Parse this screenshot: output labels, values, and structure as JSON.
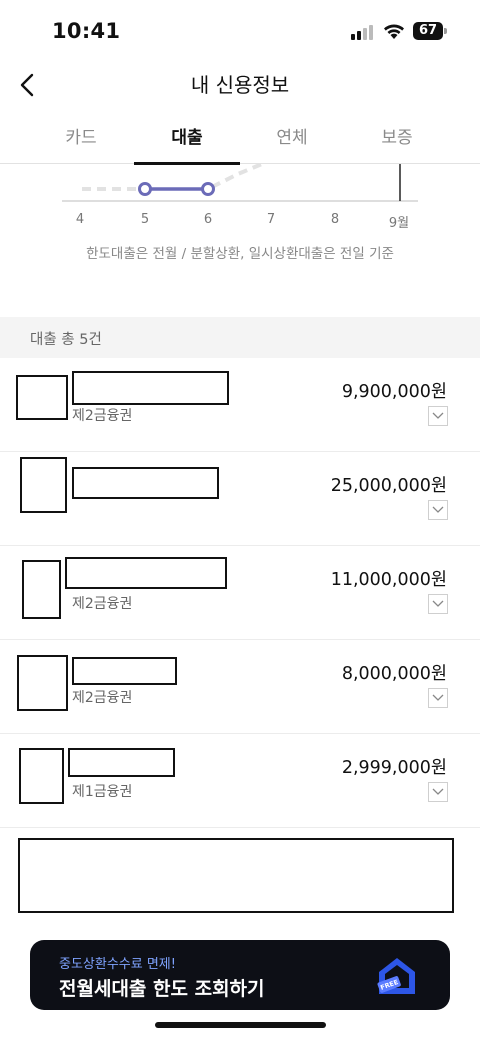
{
  "status_bar": {
    "time": "10:41",
    "battery": "67",
    "icons": [
      "signal-icon",
      "wifi-icon",
      "battery-icon"
    ]
  },
  "header": {
    "title": "내 신용정보",
    "back_icon": "chevron-left-icon"
  },
  "tabs": [
    {
      "label": "카드",
      "active": false
    },
    {
      "label": "대출",
      "active": true
    },
    {
      "label": "연체",
      "active": false
    },
    {
      "label": "보증",
      "active": false
    }
  ],
  "graph": {
    "x_labels": [
      "4",
      "5",
      "6",
      "7",
      "8",
      "9월"
    ],
    "note": "한도대출은 전월 / 분할상환, 일시상환대출은 전일 기준",
    "accent_color": "#6b6bb8"
  },
  "loans_section": {
    "title": "대출 총 5건",
    "items": [
      {
        "category": "제2금융권",
        "amount": "9,900,000원"
      },
      {
        "category": "",
        "amount": "25,000,000원"
      },
      {
        "category": "제2금융권",
        "amount": "11,000,000원"
      },
      {
        "category": "제2금융권",
        "amount": "8,000,000원"
      },
      {
        "category": "제1금융권",
        "amount": "2,999,000원"
      }
    ]
  },
  "banner": {
    "subtitle": "중도상환수수료 면제!",
    "title": "전월세대출 한도 조회하기",
    "badge": "FREE",
    "subtitle_color": "#7fa3ff",
    "icon": "house-free-icon"
  }
}
